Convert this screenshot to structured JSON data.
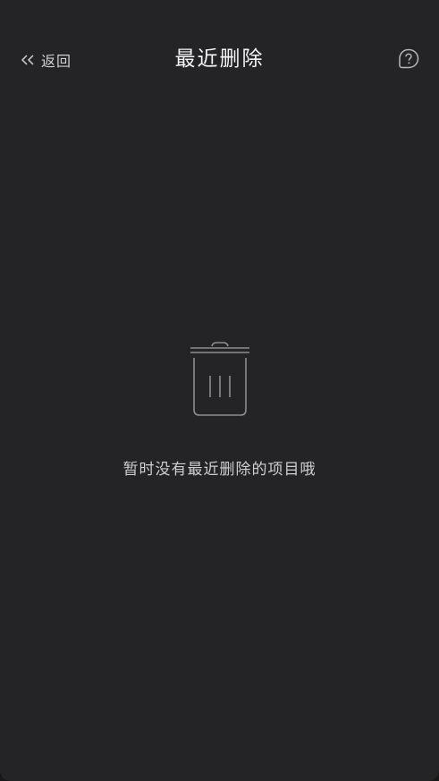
{
  "header": {
    "back_label": "返回",
    "title": "最近删除"
  },
  "icons": {
    "back": "double-chevron-left-icon",
    "help": "question-bubble-icon",
    "empty": "trash-can-icon"
  },
  "empty_state": {
    "message": "暂时没有最近删除的项目哦"
  },
  "colors": {
    "background": "#242325",
    "title": "#f4f4f4",
    "text": "#cfcfcf",
    "icon": "#8e8e8e"
  }
}
